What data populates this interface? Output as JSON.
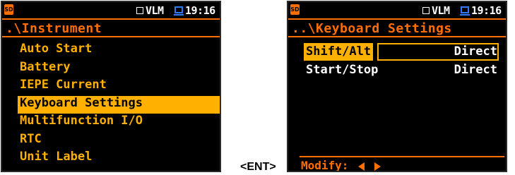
{
  "status": {
    "sd_label": "SD",
    "mode": "VLM",
    "time": "19:16"
  },
  "left_screen": {
    "title": ".\\Instrument",
    "items": [
      {
        "label": "Auto Start"
      },
      {
        "label": "Battery"
      },
      {
        "label": "IEPE Current"
      },
      {
        "label": "Keyboard Settings",
        "selected": true
      },
      {
        "label": "Multifunction I/O"
      },
      {
        "label": "RTC"
      },
      {
        "label": "Unit Label"
      }
    ]
  },
  "transition_label": "<ENT>",
  "right_screen": {
    "title": "..\\Keyboard Settings",
    "rows": [
      {
        "label": "Shift/Alt",
        "value": "Direct",
        "focused": true
      },
      {
        "label": "Start/Stop",
        "value": "Direct"
      }
    ],
    "hint": "Modify:"
  },
  "colors": {
    "screen_bg": "#000000",
    "accent_orange": "#ff6e00",
    "item_yellow": "#ffb000",
    "battery_blue": "#2e7bff"
  }
}
